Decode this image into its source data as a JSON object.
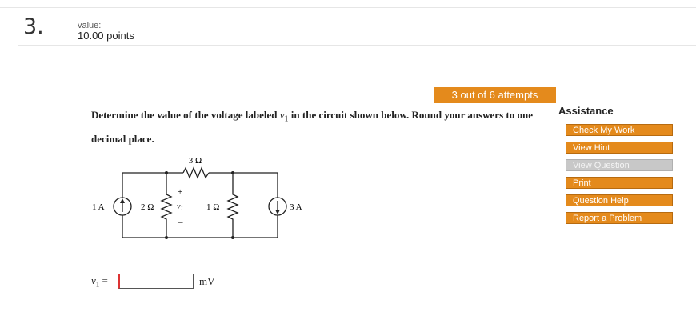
{
  "question": {
    "number": "3.",
    "value_label": "value:",
    "points": "10.00 points",
    "text_before": "Determine the value of the voltage labeled ",
    "variable": "v",
    "variable_sub": "1",
    "text_after": " in the circuit shown below. Round your answers to one decimal place."
  },
  "attempts": "3 out of 6 attempts",
  "assistance": {
    "title": "Assistance",
    "buttons": [
      {
        "label": "Check My Work",
        "enabled": true
      },
      {
        "label": "View Hint",
        "enabled": true
      },
      {
        "label": "View Question",
        "enabled": false
      },
      {
        "label": "Print",
        "enabled": true
      },
      {
        "label": "Question Help",
        "enabled": true
      },
      {
        "label": "Report a Problem",
        "enabled": true
      }
    ]
  },
  "circuit": {
    "labels": {
      "top_resistor": "3 Ω",
      "left_source": "1 A",
      "r_2ohm": "2 Ω",
      "r_1ohm": "1 Ω",
      "right_source": "3 A",
      "plus": "+",
      "minus": "–",
      "v_var": "v",
      "v_sub": "1"
    }
  },
  "answer": {
    "label_var": "v",
    "label_sub": "1",
    "equals": "=",
    "value": "",
    "unit": "mV"
  }
}
